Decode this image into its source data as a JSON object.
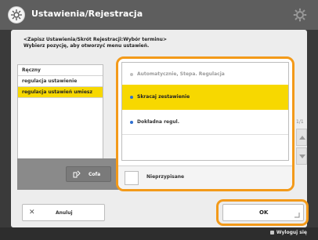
{
  "window": {
    "title": "Ustawienia/Rejestracja"
  },
  "instruction": {
    "line1": "<Zapisz Ustawienia/Skrót Rejestracji:Wybór terminu>",
    "line2": "Wybierz pozycję, aby otworzyć menu ustawień."
  },
  "left_list": {
    "items": [
      {
        "label": "Ręczny"
      },
      {
        "label": "regulacja ustawienie"
      },
      {
        "label": "regulacja ustawień umiesz"
      }
    ],
    "selected_index": 2
  },
  "change_button": {
    "label": "Cofa"
  },
  "popup": {
    "options": [
      {
        "label": "Automatycznie, Stepa. Regulacja"
      },
      {
        "label": "Skracaj zestawienie"
      },
      {
        "label": "Dokładna regul."
      }
    ],
    "selected_index": 1,
    "footer_label": "Nieprzypisane"
  },
  "scroll": {
    "side_label": "1/1"
  },
  "buttons": {
    "cancel": "Anuluj",
    "ok": "OK"
  },
  "status": {
    "label": "Wyloguj się"
  },
  "colors": {
    "accent": "#f39a1a",
    "selection": "#f7d800",
    "title_bar": "#5e5e5e"
  }
}
